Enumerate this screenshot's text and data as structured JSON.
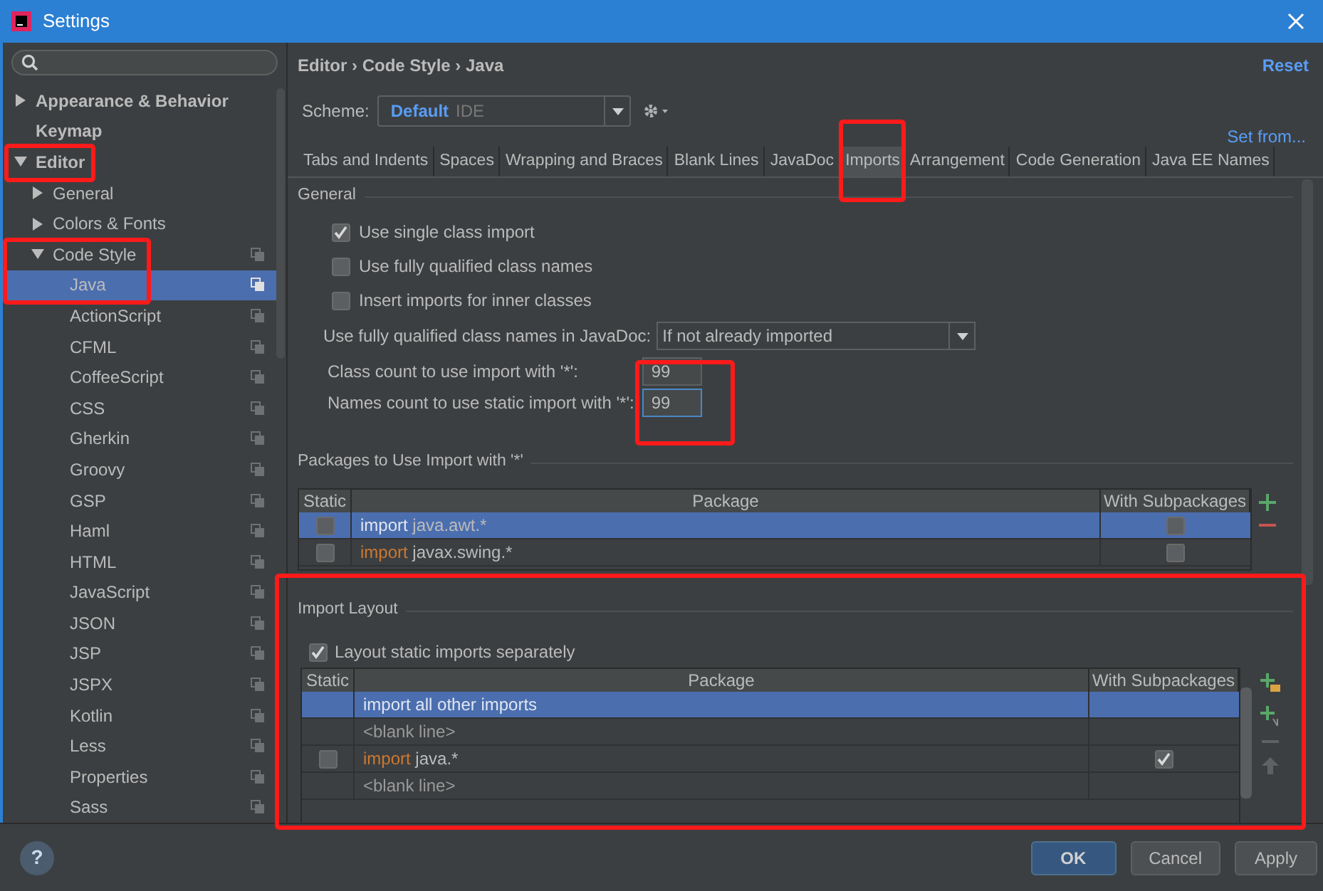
{
  "window": {
    "title": "Settings"
  },
  "sidebar": {
    "items": [
      {
        "label": "Appearance & Behavior",
        "expanded": false,
        "selected": false
      },
      {
        "label": "Keymap",
        "selected": false
      },
      {
        "label": "Editor",
        "expanded": true,
        "selected": false,
        "children": [
          {
            "label": "General",
            "expanded": false,
            "selected": false
          },
          {
            "label": "Colors & Fonts",
            "expanded": false,
            "selected": false
          },
          {
            "label": "Code Style",
            "kind": "scheme",
            "expanded": true,
            "selected": false,
            "children": [
              {
                "label": "Java",
                "kind": "scheme",
                "selected": true
              },
              {
                "label": "ActionScript",
                "kind": "scheme",
                "selected": false
              },
              {
                "label": "CFML",
                "kind": "scheme",
                "selected": false
              },
              {
                "label": "CoffeeScript",
                "kind": "scheme",
                "selected": false
              },
              {
                "label": "CSS",
                "kind": "scheme",
                "selected": false
              },
              {
                "label": "Gherkin",
                "kind": "scheme",
                "selected": false
              },
              {
                "label": "Groovy",
                "kind": "scheme",
                "selected": false
              },
              {
                "label": "GSP",
                "kind": "scheme",
                "selected": false
              },
              {
                "label": "Haml",
                "kind": "scheme",
                "selected": false
              },
              {
                "label": "HTML",
                "kind": "scheme",
                "selected": false
              },
              {
                "label": "JavaScript",
                "kind": "scheme",
                "selected": false
              },
              {
                "label": "JSON",
                "kind": "scheme",
                "selected": false
              },
              {
                "label": "JSP",
                "kind": "scheme",
                "selected": false
              },
              {
                "label": "JSPX",
                "kind": "scheme",
                "selected": false
              },
              {
                "label": "Kotlin",
                "kind": "scheme",
                "selected": false
              },
              {
                "label": "Less",
                "kind": "scheme",
                "selected": false
              },
              {
                "label": "Properties",
                "kind": "scheme",
                "selected": false
              },
              {
                "label": "Sass",
                "kind": "scheme",
                "selected": false
              }
            ]
          }
        ]
      }
    ]
  },
  "breadcrumb": "Editor › Code Style › Java",
  "reset_link": "Reset",
  "scheme": {
    "label": "Scheme:",
    "name": "Default",
    "scope": "IDE"
  },
  "set_from_link": "Set from...",
  "tabs": [
    {
      "label": "Tabs and Indents",
      "selected": false
    },
    {
      "label": "Spaces",
      "selected": false
    },
    {
      "label": "Wrapping and Braces",
      "selected": false
    },
    {
      "label": "Blank Lines",
      "selected": false
    },
    {
      "label": "JavaDoc",
      "selected": false
    },
    {
      "label": "Imports",
      "selected": true
    },
    {
      "label": "Arrangement",
      "selected": false
    },
    {
      "label": "Code Generation",
      "selected": false
    },
    {
      "label": "Java EE Names",
      "selected": false
    }
  ],
  "general": {
    "title": "General",
    "options": [
      {
        "label": "Use single class import",
        "checked": true
      },
      {
        "label": "Use fully qualified class names",
        "checked": false
      },
      {
        "label": "Insert imports for inner classes",
        "checked": false
      }
    ],
    "javadoc": {
      "label": "Use fully qualified class names in JavaDoc:",
      "value": "If not already imported"
    },
    "counts": [
      {
        "label": "Class count to use import with '*':",
        "value": "99",
        "focused": false
      },
      {
        "label": "Names count to use static import with '*':",
        "value": "99",
        "focused": true
      }
    ]
  },
  "packages": {
    "title": "Packages to Use Import with '*'",
    "columns": [
      "Static",
      "Package",
      "With Subpackages"
    ],
    "rows": [
      {
        "kind": "package",
        "static": false,
        "keyword": "import",
        "name": "java.awt.*",
        "subpackages": false,
        "selected": true
      },
      {
        "kind": "package",
        "static": false,
        "keyword": "import",
        "name": "javax.swing.*",
        "subpackages": false,
        "selected": false
      }
    ]
  },
  "import_layout": {
    "title": "Import Layout",
    "separate_static": {
      "label": "Layout static imports separately",
      "checked": true
    },
    "columns": [
      "Static",
      "Package",
      "With Subpackages"
    ],
    "rows": [
      {
        "kind": "all_other",
        "text": "import all other imports",
        "selected": true
      },
      {
        "kind": "blank",
        "text": "<blank line>",
        "selected": false
      },
      {
        "kind": "package",
        "static": false,
        "keyword": "import",
        "name": "java.*",
        "subpackages": true,
        "selected": false
      },
      {
        "kind": "blank",
        "text": "<blank line>",
        "selected": false
      }
    ]
  },
  "help": "?",
  "buttons": [
    {
      "label": "OK",
      "default": true
    },
    {
      "label": "Cancel",
      "default": false
    },
    {
      "label": "Apply",
      "default": false
    }
  ]
}
